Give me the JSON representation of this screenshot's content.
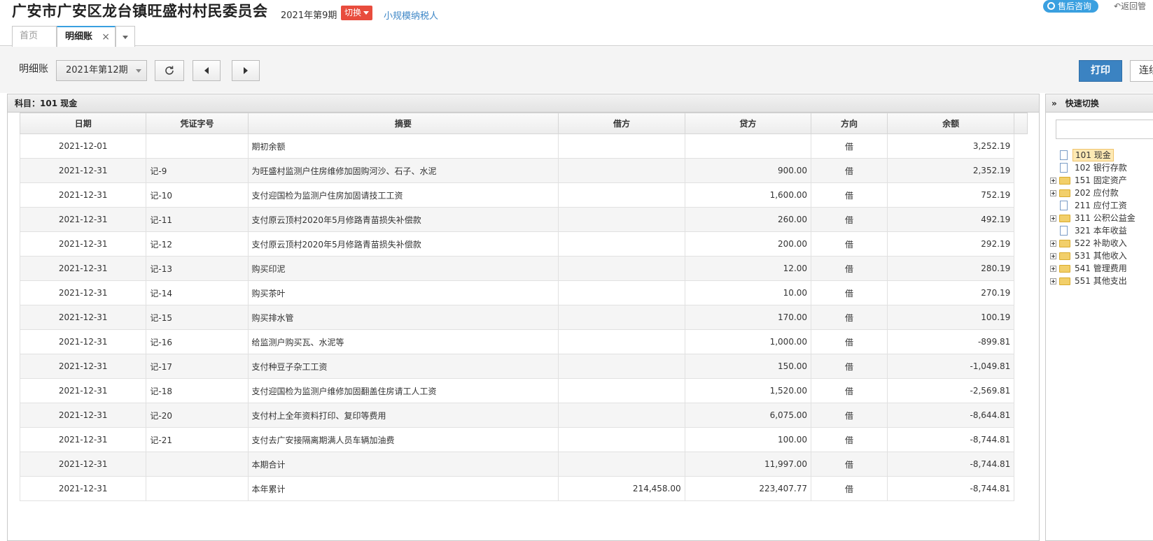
{
  "header": {
    "org_title": "广安市广安区龙台镇旺盛村村民委员会",
    "period": "2021年第9期",
    "switch_label": "切换",
    "taxpayer": "小规模纳税人",
    "service_label": "售后咨询",
    "back_label": "返回管"
  },
  "tabs": {
    "home": "首页",
    "active": "明细账",
    "close": "×"
  },
  "toolbar": {
    "label": "明细账",
    "period_select": "2021年第12期",
    "print_label": "打印",
    "continuous_label": "连续"
  },
  "panel": {
    "subject_title": "科目：101  现金"
  },
  "ledger": {
    "columns": [
      "日期",
      "凭证字号",
      "摘要",
      "借方",
      "贷方",
      "方向",
      "余额"
    ],
    "rows": [
      {
        "date": "2021-12-01",
        "voucher": "",
        "summary": "期初余额",
        "debit": "",
        "credit": "",
        "dir": "借",
        "balance": "3,252.19",
        "indent": true
      },
      {
        "date": "2021-12-31",
        "voucher": "记-9",
        "summary": "为旺盛村监测户住房维修加固购河沙、石子、水泥",
        "debit": "",
        "credit": "900.00",
        "dir": "借",
        "balance": "2,352.19"
      },
      {
        "date": "2021-12-31",
        "voucher": "记-10",
        "summary": "支付迎国检为监测户住房加固请技工工资",
        "debit": "",
        "credit": "1,600.00",
        "dir": "借",
        "balance": "752.19"
      },
      {
        "date": "2021-12-31",
        "voucher": "记-11",
        "summary": "支付原云顶村2020年5月修路青苗损失补偿款",
        "debit": "",
        "credit": "260.00",
        "dir": "借",
        "balance": "492.19"
      },
      {
        "date": "2021-12-31",
        "voucher": "记-12",
        "summary": "支付原云顶村2020年5月修路青苗损失补偿款",
        "debit": "",
        "credit": "200.00",
        "dir": "借",
        "balance": "292.19"
      },
      {
        "date": "2021-12-31",
        "voucher": "记-13",
        "summary": "购买印泥",
        "debit": "",
        "credit": "12.00",
        "dir": "借",
        "balance": "280.19"
      },
      {
        "date": "2021-12-31",
        "voucher": "记-14",
        "summary": "购买茶叶",
        "debit": "",
        "credit": "10.00",
        "dir": "借",
        "balance": "270.19"
      },
      {
        "date": "2021-12-31",
        "voucher": "记-15",
        "summary": "购买排水管",
        "debit": "",
        "credit": "170.00",
        "dir": "借",
        "balance": "100.19"
      },
      {
        "date": "2021-12-31",
        "voucher": "记-16",
        "summary": "给监测户购买瓦、水泥等",
        "debit": "",
        "credit": "1,000.00",
        "dir": "借",
        "balance": "-899.81"
      },
      {
        "date": "2021-12-31",
        "voucher": "记-17",
        "summary": "支付种豆子杂工工资",
        "debit": "",
        "credit": "150.00",
        "dir": "借",
        "balance": "-1,049.81"
      },
      {
        "date": "2021-12-31",
        "voucher": "记-18",
        "summary": "支付迎国检为监测户维修加固翻盖住房请工人工资",
        "debit": "",
        "credit": "1,520.00",
        "dir": "借",
        "balance": "-2,569.81"
      },
      {
        "date": "2021-12-31",
        "voucher": "记-20",
        "summary": "支付村上全年资料打印、复印等费用",
        "debit": "",
        "credit": "6,075.00",
        "dir": "借",
        "balance": "-8,644.81"
      },
      {
        "date": "2021-12-31",
        "voucher": "记-21",
        "summary": "支付去广安接隔离期满人员车辆加油费",
        "debit": "",
        "credit": "100.00",
        "dir": "借",
        "balance": "-8,744.81"
      },
      {
        "date": "2021-12-31",
        "voucher": "",
        "summary": "本期合计",
        "debit": "",
        "credit": "11,997.00",
        "dir": "借",
        "balance": "-8,744.81",
        "indent": true
      },
      {
        "date": "2021-12-31",
        "voucher": "",
        "summary": "本年累计",
        "debit": "214,458.00",
        "credit": "223,407.77",
        "dir": "借",
        "balance": "-8,744.81",
        "indent": true
      }
    ]
  },
  "side": {
    "title": "快速切换",
    "tree": [
      {
        "label": "101 现金",
        "type": "file",
        "selected": true
      },
      {
        "label": "102 银行存款",
        "type": "file"
      },
      {
        "label": "151 固定资产",
        "type": "folder"
      },
      {
        "label": "202 应付款",
        "type": "folder"
      },
      {
        "label": "211 应付工资",
        "type": "file"
      },
      {
        "label": "311 公积公益金",
        "type": "folder"
      },
      {
        "label": "321 本年收益",
        "type": "file"
      },
      {
        "label": "522 补助收入",
        "type": "folder"
      },
      {
        "label": "531 其他收入",
        "type": "folder"
      },
      {
        "label": "541 管理费用",
        "type": "folder"
      },
      {
        "label": "551 其他支出",
        "type": "folder"
      }
    ]
  },
  "colors": {
    "accent_blue": "#3b83c2",
    "switch_red": "#e84c3d",
    "link_blue": "#3d86c6"
  }
}
